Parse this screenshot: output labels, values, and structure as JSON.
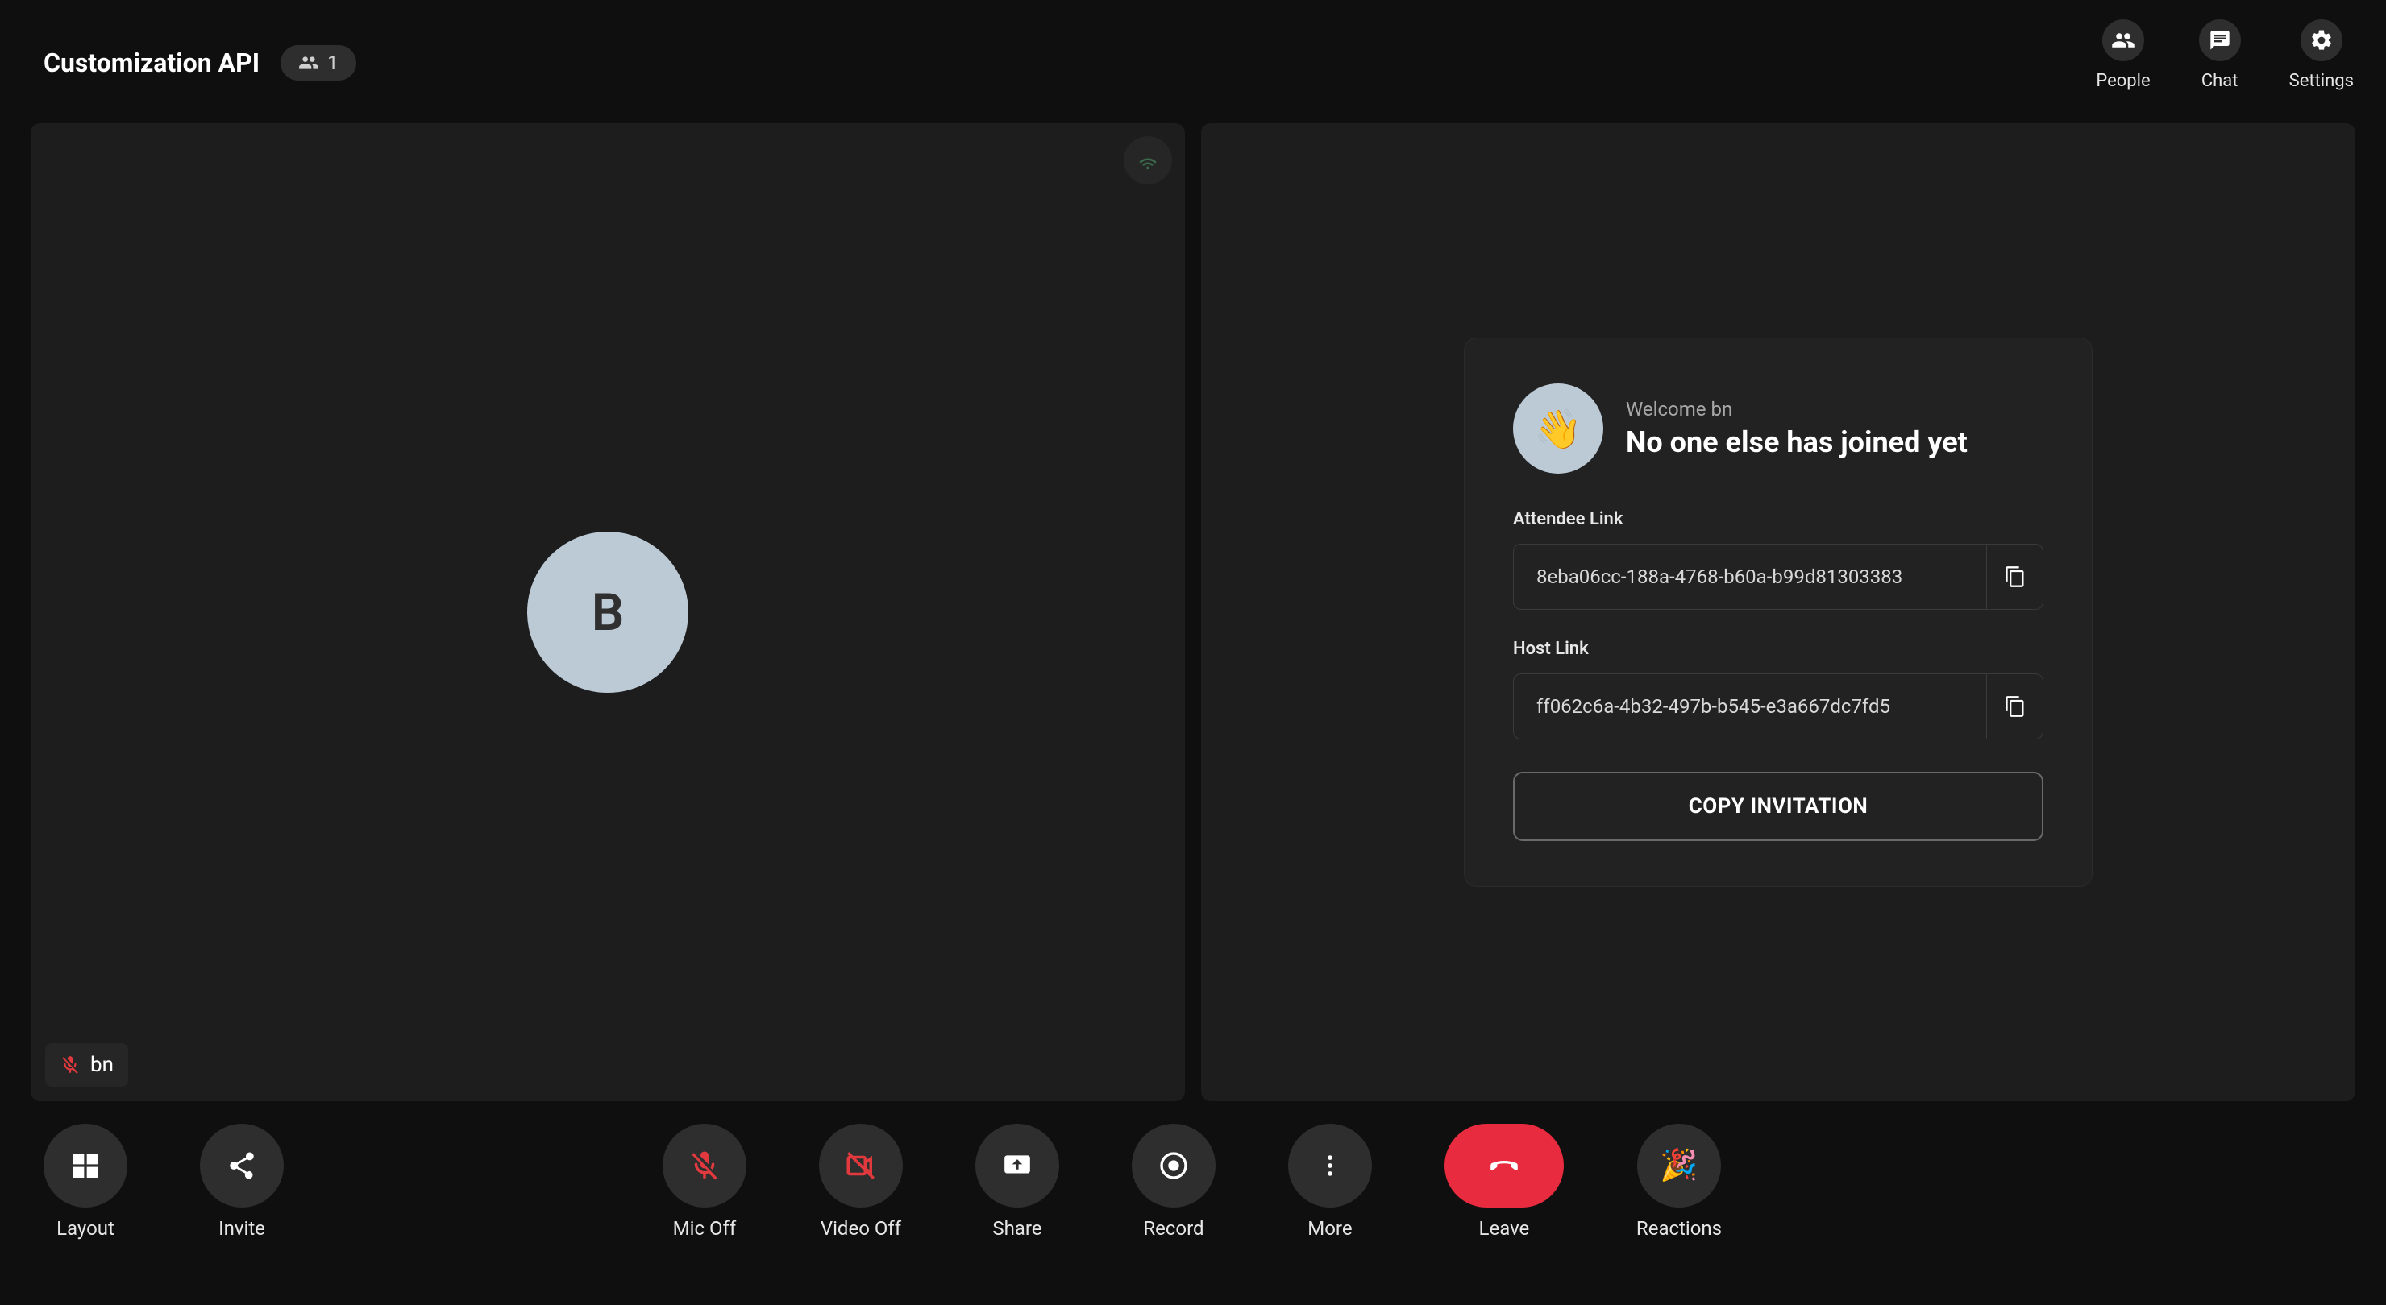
{
  "header": {
    "title": "Customization API",
    "participant_count": "1",
    "actions": {
      "people": "People",
      "chat": "Chat",
      "settings": "Settings"
    }
  },
  "participant": {
    "avatar_initial": "B",
    "name": "bn"
  },
  "welcome": {
    "greeting": "Welcome bn",
    "headline": "No one else has joined yet",
    "attendee_label": "Attendee Link",
    "attendee_link": "8eba06cc-188a-4768-b60a-b99d81303383",
    "host_label": "Host Link",
    "host_link": "ff062c6a-4b32-497b-b545-e3a667dc7fd5",
    "copy_invitation": "COPY INVITATION"
  },
  "controls": {
    "layout": "Layout",
    "invite": "Invite",
    "mic_off": "Mic Off",
    "video_off": "Video Off",
    "share": "Share",
    "record": "Record",
    "more": "More",
    "leave": "Leave",
    "reactions": "Reactions"
  },
  "colors": {
    "red": "#e2393e",
    "leave": "#e82b3e",
    "avatar": "#bccad6"
  }
}
